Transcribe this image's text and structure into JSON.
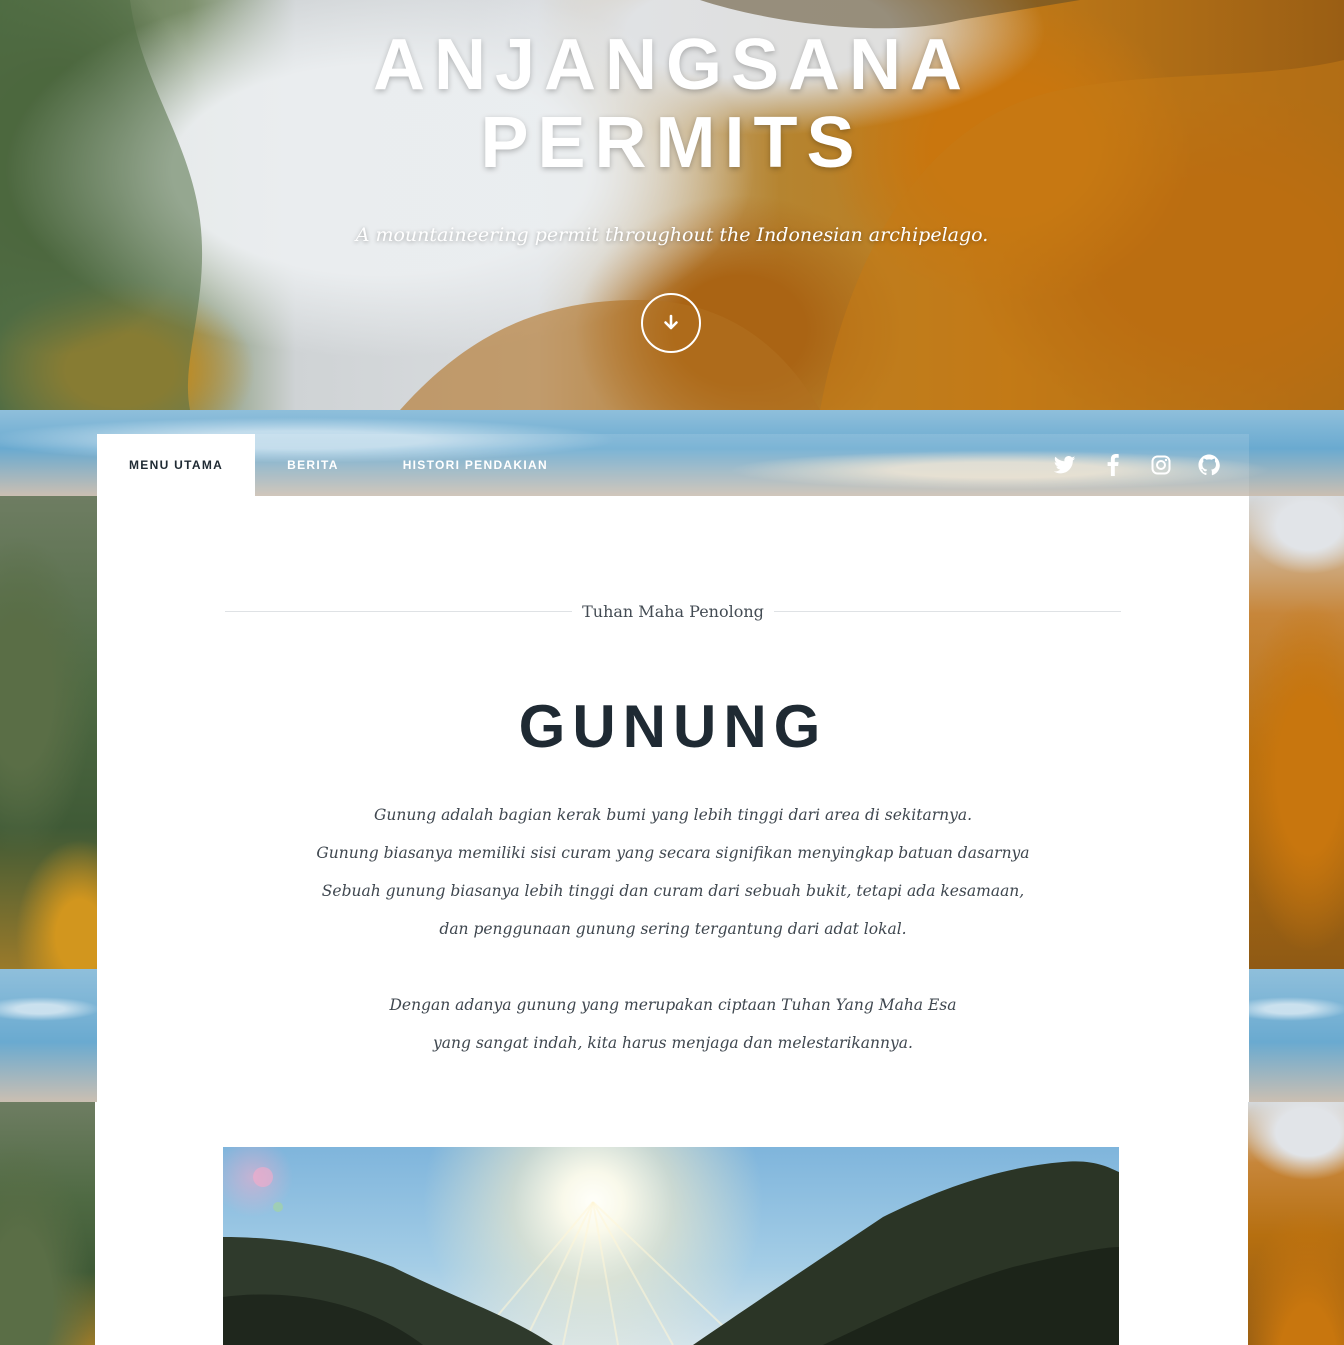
{
  "hero": {
    "title_line1": "ANJANGSANA",
    "title_line2": "PERMITS",
    "tagline": "A mountaineering permit throughout the Indonesian archipelago.",
    "scroll_icon": "arrow-down-circle-icon"
  },
  "nav": {
    "items": [
      {
        "label": "MENU UTAMA",
        "active": true
      },
      {
        "label": "BERITA",
        "active": false
      },
      {
        "label": "HISTORI PENDAKIAN",
        "active": false
      }
    ],
    "social": [
      "twitter-icon",
      "facebook-icon",
      "instagram-icon",
      "github-icon"
    ]
  },
  "main": {
    "eyebrow": "Tuhan Maha Penolong",
    "title": "GUNUNG",
    "paragraph1": [
      "Gunung adalah bagian kerak bumi yang lebih tinggi dari area di sekitarnya.",
      "Gunung biasanya memiliki sisi curam yang secara signifikan menyingkap batuan dasarnya",
      "Sebuah gunung biasanya lebih tinggi dan curam dari sebuah bukit, tetapi ada kesamaan,",
      "dan penggunaan gunung sering tergantung dari adat lokal."
    ],
    "paragraph2": [
      "Dengan adanya gunung yang merupakan ciptaan Tuhan Yang Maha Esa",
      "yang sangat indah, kita harus menjaga dan melestarikannya."
    ]
  },
  "colors": {
    "heading_dark": "#1f2a33",
    "body_text": "#3f474f",
    "divider": "#dfe2e5",
    "nav_active_bg": "#ffffff"
  }
}
